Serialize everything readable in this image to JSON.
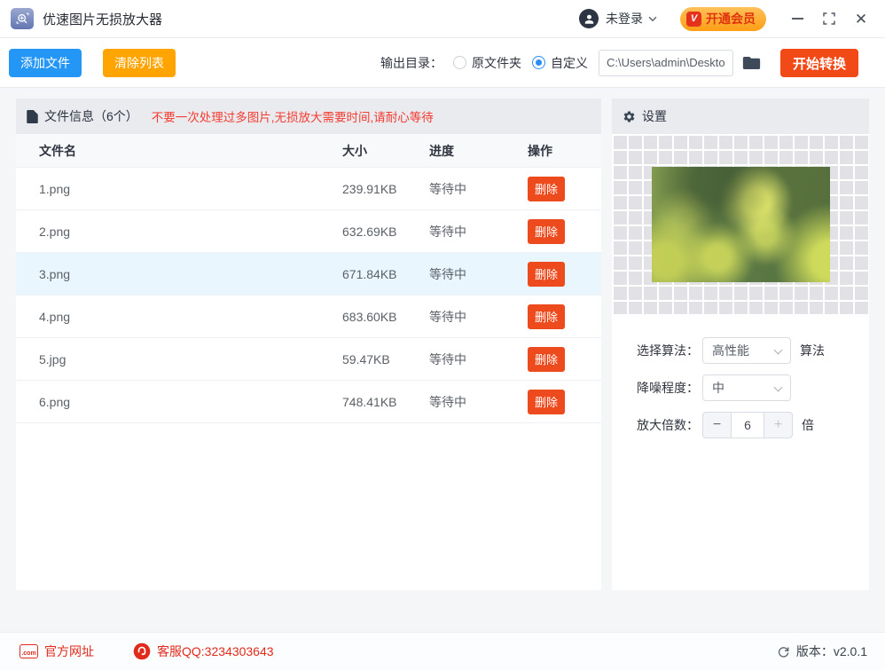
{
  "window": {
    "title": "优速图片无损放大器",
    "login_label": "未登录",
    "vip_button": "开通会员",
    "vip_badge": "V"
  },
  "toolbar": {
    "add_files": "添加文件",
    "clear_list": "清除列表",
    "output_dir_label": "输出目录：",
    "radio_original": "原文件夹",
    "radio_custom": "自定义",
    "path_value": "C:\\Users\\admin\\Deskto",
    "start_convert": "开始转换"
  },
  "file_panel": {
    "header": "文件信息（6个）",
    "warning": "不要一次处理过多图片,无损放大需要时间,请耐心等待",
    "columns": [
      "文件名",
      "大小",
      "进度",
      "操作"
    ],
    "delete_label": "删除",
    "rows": [
      {
        "name": "1.png",
        "size": "239.91KB",
        "status": "等待中"
      },
      {
        "name": "2.png",
        "size": "632.69KB",
        "status": "等待中"
      },
      {
        "name": "3.png",
        "size": "671.84KB",
        "status": "等待中"
      },
      {
        "name": "4.png",
        "size": "683.60KB",
        "status": "等待中"
      },
      {
        "name": "5.jpg",
        "size": "59.47KB",
        "status": "等待中"
      },
      {
        "name": "6.png",
        "size": "748.41KB",
        "status": "等待中"
      }
    ]
  },
  "settings_panel": {
    "header": "设置",
    "algorithm_label": "选择算法：",
    "algorithm_value": "高性能",
    "algorithm_suffix": "算法",
    "denoise_label": "降噪程度：",
    "denoise_value": "中",
    "scale_label": "放大倍数：",
    "scale_value": "6",
    "scale_suffix": "倍",
    "minus_glyph": "−",
    "plus_glyph": "+"
  },
  "footer": {
    "com_icon_text": ".com",
    "official_site": "官方网址",
    "qq_service": "客服QQ:3234303643",
    "version_label": "版本：",
    "version_value": "v2.0.1"
  },
  "colors": {
    "primary_blue": "#2496f5",
    "orange": "#ffa400",
    "action_red": "#f24a17",
    "delete_red": "#ed4a1d",
    "warning_red": "#f43b30",
    "footer_red": "#e02a1c",
    "radio_blue": "#2d8cf0",
    "row_highlight": "#e9f6fe",
    "vip_gradient_top": "#ffc159",
    "vip_gradient_bottom": "#ff9e14"
  }
}
